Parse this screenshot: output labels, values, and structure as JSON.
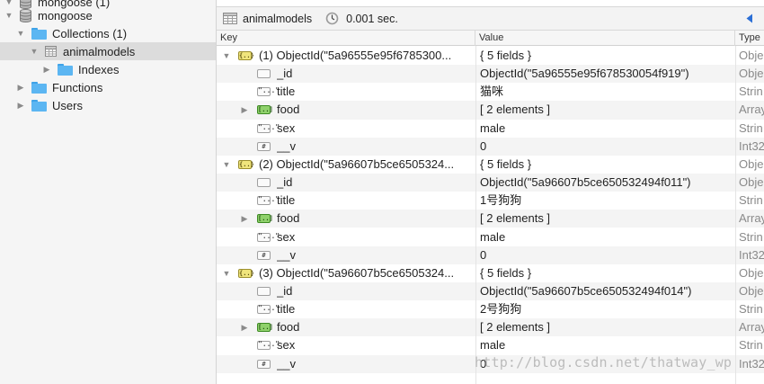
{
  "sidebar": {
    "items": [
      {
        "label": "mongoose (1)",
        "level": 0,
        "icon": "database-icon",
        "expanded": true
      },
      {
        "label": "mongoose",
        "level": 0,
        "icon": "database-icon",
        "expanded": true
      },
      {
        "label": "Collections (1)",
        "level": 1,
        "icon": "folder-icon",
        "expanded": true
      },
      {
        "label": "animalmodels",
        "level": 2,
        "icon": "table-icon",
        "expanded": true,
        "selected": true
      },
      {
        "label": "Indexes",
        "level": 3,
        "icon": "folder-icon",
        "expanded": false
      },
      {
        "label": "Functions",
        "level": 1,
        "icon": "folder-icon",
        "expanded": false
      },
      {
        "label": "Users",
        "level": 1,
        "icon": "folder-icon",
        "expanded": false
      }
    ]
  },
  "toolbar": {
    "collection": "animalmodels",
    "collection_icon": "table-icon",
    "time_icon": "clock-icon",
    "time": "0.001 sec.",
    "nav_icon": "back-arrow-icon"
  },
  "table": {
    "columns": [
      "Key",
      "Value",
      "Type"
    ],
    "rows": [
      {
        "level": 0,
        "tri": "open",
        "icon": "obj",
        "key": "(1) ObjectId(\"5a96555e95f6785300...",
        "value": "{ 5 fields }",
        "type": "Obje"
      },
      {
        "level": 1,
        "tri": "",
        "icon": "oid",
        "key": "_id",
        "value": "ObjectId(\"5a96555e95f678530054f919\")",
        "type": "Obje"
      },
      {
        "level": 1,
        "tri": "",
        "icon": "str",
        "key": "title",
        "value": "猫咪",
        "type": "Strin"
      },
      {
        "level": 1,
        "tri": "closed",
        "icon": "arr",
        "key": "food",
        "value": "[ 2 elements ]",
        "type": "Array"
      },
      {
        "level": 1,
        "tri": "",
        "icon": "str",
        "key": "sex",
        "value": "male",
        "type": "Strin"
      },
      {
        "level": 1,
        "tri": "",
        "icon": "num",
        "key": "__v",
        "value": "0",
        "type": "Int32"
      },
      {
        "level": 0,
        "tri": "open",
        "icon": "obj",
        "key": "(2) ObjectId(\"5a96607b5ce6505324...",
        "value": "{ 5 fields }",
        "type": "Obje"
      },
      {
        "level": 1,
        "tri": "",
        "icon": "oid",
        "key": "_id",
        "value": "ObjectId(\"5a96607b5ce650532494f011\")",
        "type": "Obje"
      },
      {
        "level": 1,
        "tri": "",
        "icon": "str",
        "key": "title",
        "value": "1号狗狗",
        "type": "Strin"
      },
      {
        "level": 1,
        "tri": "closed",
        "icon": "arr",
        "key": "food",
        "value": "[ 2 elements ]",
        "type": "Array"
      },
      {
        "level": 1,
        "tri": "",
        "icon": "str",
        "key": "sex",
        "value": "male",
        "type": "Strin"
      },
      {
        "level": 1,
        "tri": "",
        "icon": "num",
        "key": "__v",
        "value": "0",
        "type": "Int32"
      },
      {
        "level": 0,
        "tri": "open",
        "icon": "obj",
        "key": "(3) ObjectId(\"5a96607b5ce6505324...",
        "value": "{ 5 fields }",
        "type": "Obje"
      },
      {
        "level": 1,
        "tri": "",
        "icon": "oid",
        "key": "_id",
        "value": "ObjectId(\"5a96607b5ce650532494f014\")",
        "type": "Obje"
      },
      {
        "level": 1,
        "tri": "",
        "icon": "str",
        "key": "title",
        "value": "2号狗狗",
        "type": "Strin"
      },
      {
        "level": 1,
        "tri": "closed",
        "icon": "arr",
        "key": "food",
        "value": "[ 2 elements ]",
        "type": "Array"
      },
      {
        "level": 1,
        "tri": "",
        "icon": "str",
        "key": "sex",
        "value": "male",
        "type": "Strin"
      },
      {
        "level": 1,
        "tri": "",
        "icon": "num",
        "key": "__v",
        "value": "0",
        "type": "Int32"
      }
    ]
  },
  "watermark": "http://blog.csdn.net/thatway_wp"
}
